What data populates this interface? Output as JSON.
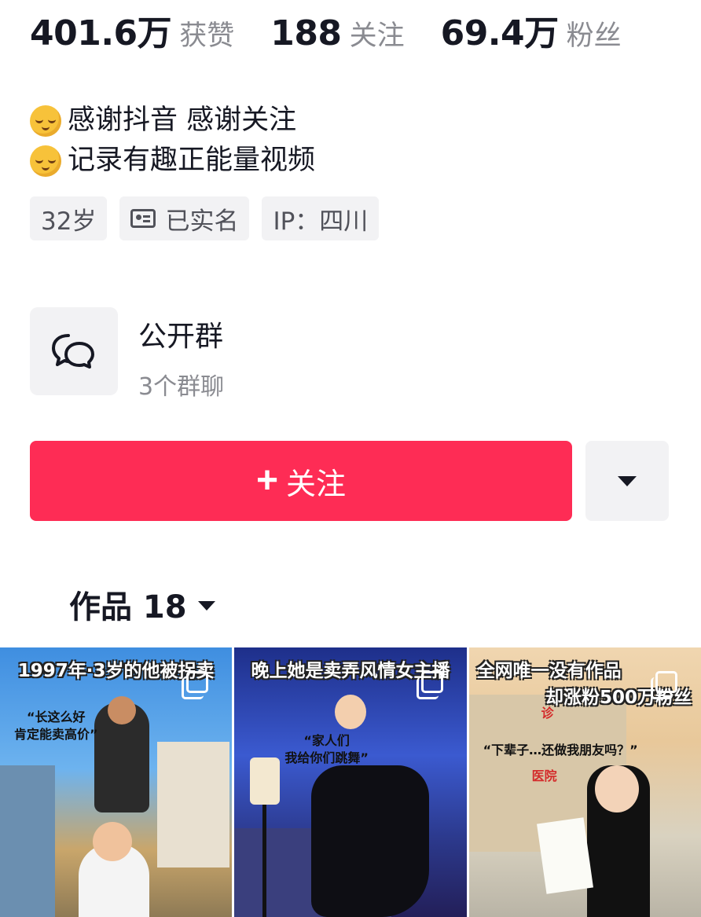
{
  "stats": [
    {
      "value": "401.6万",
      "label": "获赞"
    },
    {
      "value": "188",
      "label": "关注"
    },
    {
      "value": "69.4万",
      "label": "粉丝"
    }
  ],
  "bio": [
    {
      "icon": "relieved-face-emoji",
      "text": "感谢抖音 感谢关注"
    },
    {
      "icon": "relieved-face-emoji",
      "text": "记录有趣正能量视频"
    }
  ],
  "tags": {
    "age": "32岁",
    "verified": "已实名",
    "ip": "IP：四川"
  },
  "group": {
    "icon": "chat-bubbles-icon",
    "title": "公开群",
    "subtitle": "3个群聊"
  },
  "actions": {
    "follow_label": "关注",
    "more_icon": "caret-down-icon"
  },
  "works_tab": {
    "label": "作品 18"
  },
  "videos": [
    {
      "title": "1997年·3岁的他被拐卖",
      "quote": "“长这么好\n肯定能卖高价”"
    },
    {
      "title": "晚上她是卖弄风情女主播",
      "quote": "“家人们\n我给你们跳舞”"
    },
    {
      "title": "全网唯一没有作品",
      "title2": "却涨粉500万粉丝",
      "quote": "“下辈子…还做我朋友吗？”",
      "sign1": "诊",
      "sign2": "医院"
    }
  ],
  "colors": {
    "accent": "#fe2c55",
    "text": "#161823",
    "muted": "#8a8b91",
    "chip_bg": "#f2f2f4"
  }
}
